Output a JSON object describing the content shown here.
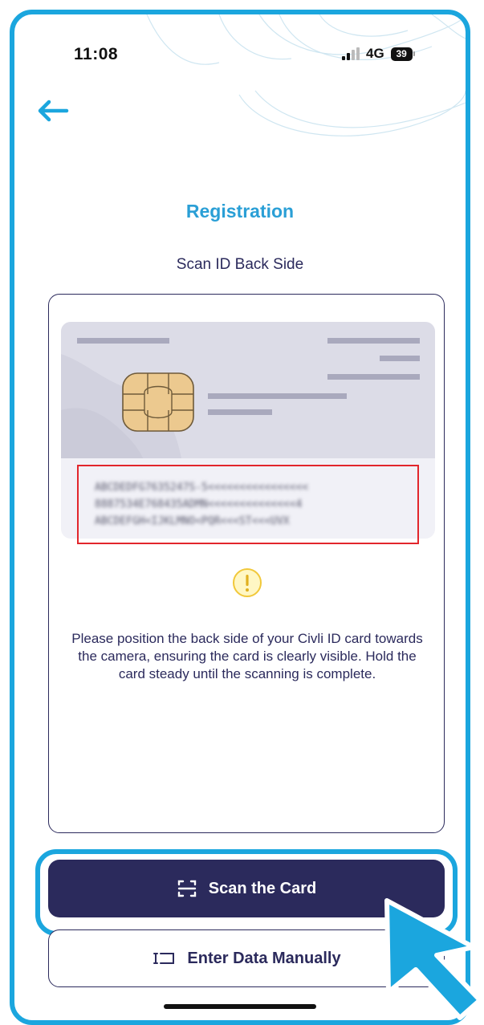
{
  "status_bar": {
    "time": "11:08",
    "network": "4G",
    "battery": "39"
  },
  "header": {
    "back_icon": "arrow-left-icon"
  },
  "page": {
    "title": "Registration",
    "subtitle": "Scan ID Back Side"
  },
  "card_preview": {
    "mrz_lines": [
      "ABCDEDFG7635247S-5<<<<<<<<<<<<<<<<",
      "8887534E768435ADMN<<<<<<<<<<<<<<4",
      "ABCDEFGH<IJKLMNO<PQR<<<ST<<<UVX"
    ],
    "chip_icon": "sim-chip-icon",
    "warning_icon": "warning-icon"
  },
  "instructions": "Please position the back side of your Civli ID card towards the camera, ensuring the card is clearly visible. Hold the card steady until the scanning is complete.",
  "actions": {
    "scan_label": "Scan the Card",
    "scan_icon": "scan-frame-icon",
    "manual_label": "Enter Data Manually",
    "manual_icon": "text-cursor-icon"
  },
  "colors": {
    "accent": "#1ba6de",
    "title": "#2a9fd6",
    "primary": "#2b2a5c",
    "mrz_border": "#e2262c",
    "warning": "#f7d64a"
  }
}
